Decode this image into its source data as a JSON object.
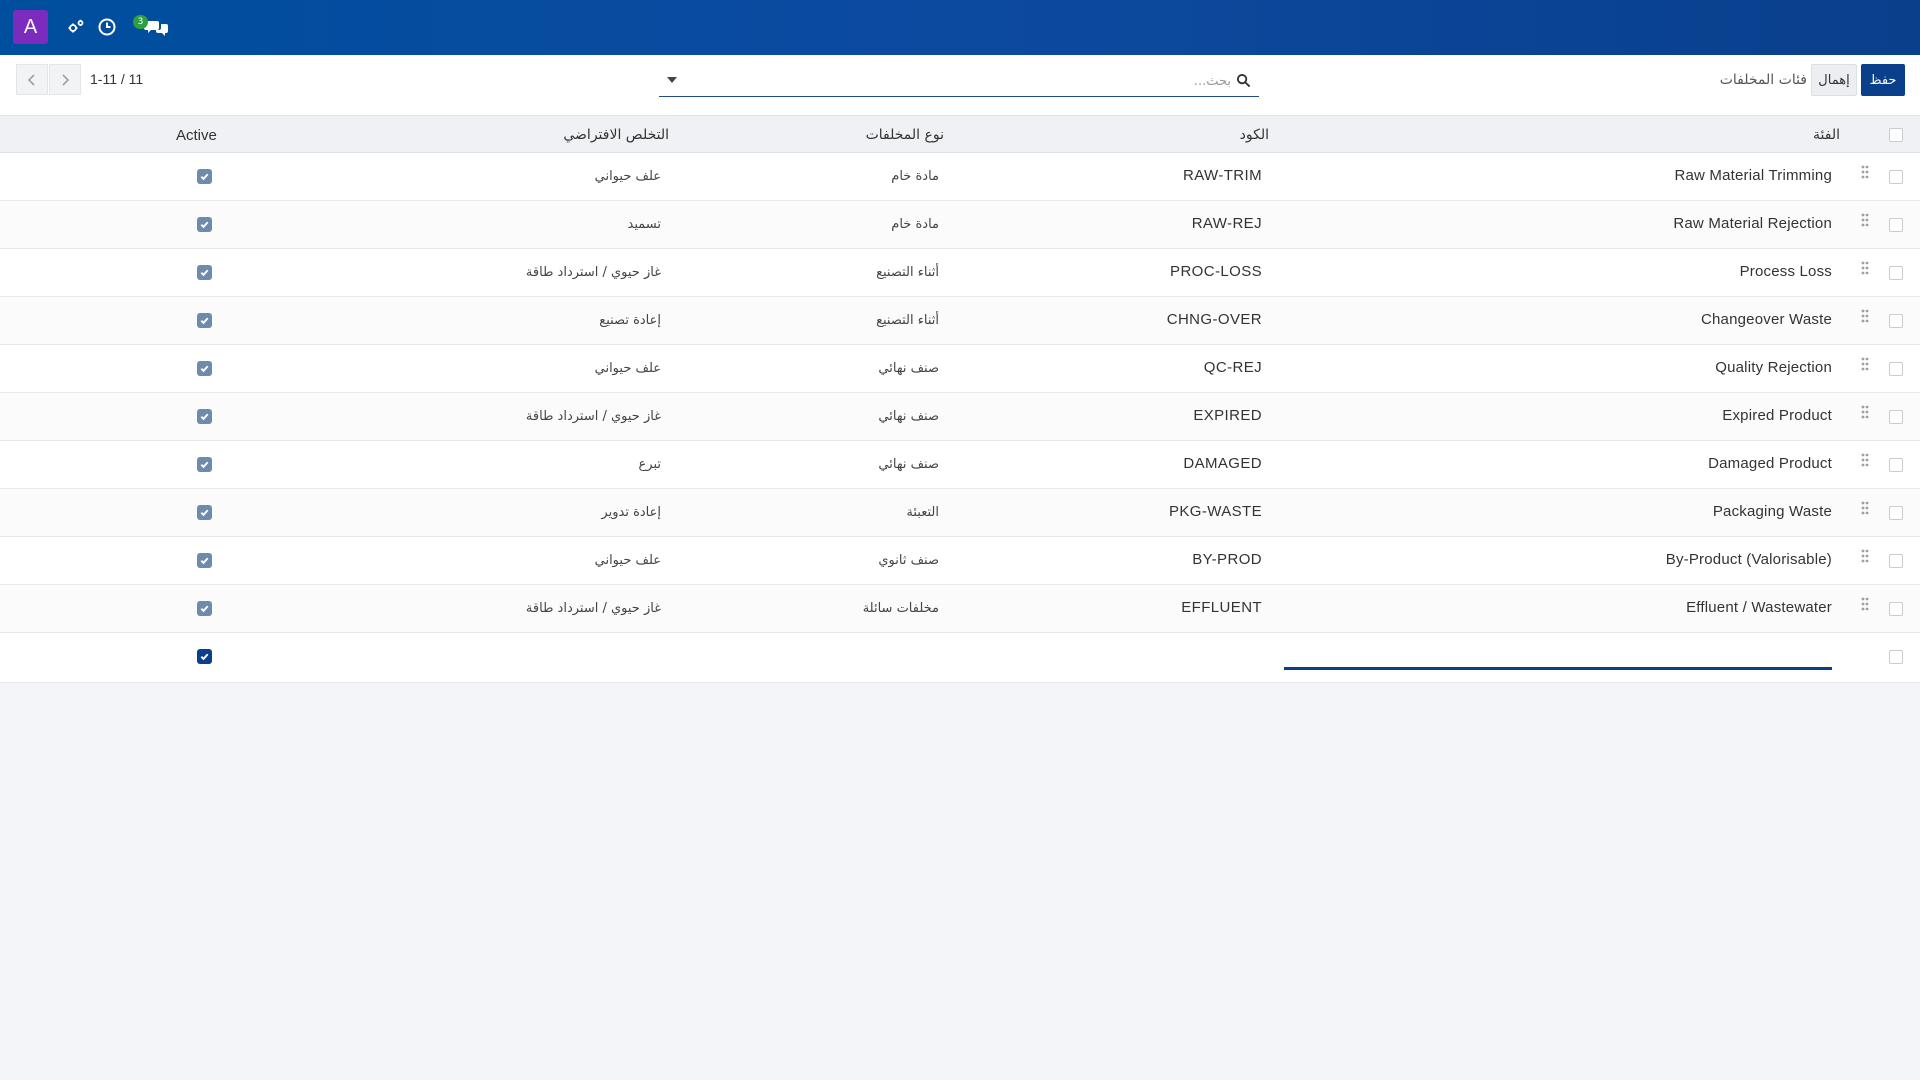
{
  "navbar": {
    "avatar_letter": "A",
    "icons": [
      "settings-icon",
      "clock-icon",
      "chat-icon"
    ],
    "chat_badge": "3"
  },
  "control": {
    "breadcrumb": "فئات المخلفات",
    "save_label": "حفظ",
    "discard_label": "إهمال",
    "search_placeholder": "بحث...",
    "pager": "1-11 / 11"
  },
  "table": {
    "headers": {
      "category": "الفئة",
      "code": "الكود",
      "waste_type": "نوع المخلفات",
      "default_disposal": "التخلص الافتراضي",
      "active": "Active"
    },
    "rows": [
      {
        "name": "Raw Material Trimming",
        "code": "RAW-TRIM",
        "type": "مادة خام",
        "disposal": "علف حيواني",
        "active": true
      },
      {
        "name": "Raw Material Rejection",
        "code": "RAW-REJ",
        "type": "مادة خام",
        "disposal": "تسميد",
        "active": true
      },
      {
        "name": "Process Loss",
        "code": "PROC-LOSS",
        "type": "أثناء التصنيع",
        "disposal": "غاز حيوي / استرداد طاقة",
        "active": true
      },
      {
        "name": "Changeover Waste",
        "code": "CHNG-OVER",
        "type": "أثناء التصنيع",
        "disposal": "إعادة تصنيع",
        "active": true
      },
      {
        "name": "Quality Rejection",
        "code": "QC-REJ",
        "type": "صنف نهائي",
        "disposal": "علف حيواني",
        "active": true
      },
      {
        "name": "Expired Product",
        "code": "EXPIRED",
        "type": "صنف نهائي",
        "disposal": "غاز حيوي / استرداد طاقة",
        "active": true
      },
      {
        "name": "Damaged Product",
        "code": "DAMAGED",
        "type": "صنف نهائي",
        "disposal": "تبرع",
        "active": true
      },
      {
        "name": "Packaging Waste",
        "code": "PKG-WASTE",
        "type": "التعبئة",
        "disposal": "إعادة تدوير",
        "active": true
      },
      {
        "name": "By-Product (Valorisable)",
        "code": "BY-PROD",
        "type": "صنف ثانوي",
        "disposal": "علف حيواني",
        "active": true
      },
      {
        "name": "Effluent / Wastewater",
        "code": "EFFLUENT",
        "type": "مخلفات سائلة",
        "disposal": "غاز حيوي / استرداد طاقة",
        "active": true
      }
    ],
    "new_row": {
      "active": true
    }
  },
  "colors": {
    "navbar": "#0a4a9a",
    "primary": "#0a3f8c",
    "avatar": "#7b2cbf",
    "badge": "#2ea043",
    "check": "#6e8bab"
  }
}
